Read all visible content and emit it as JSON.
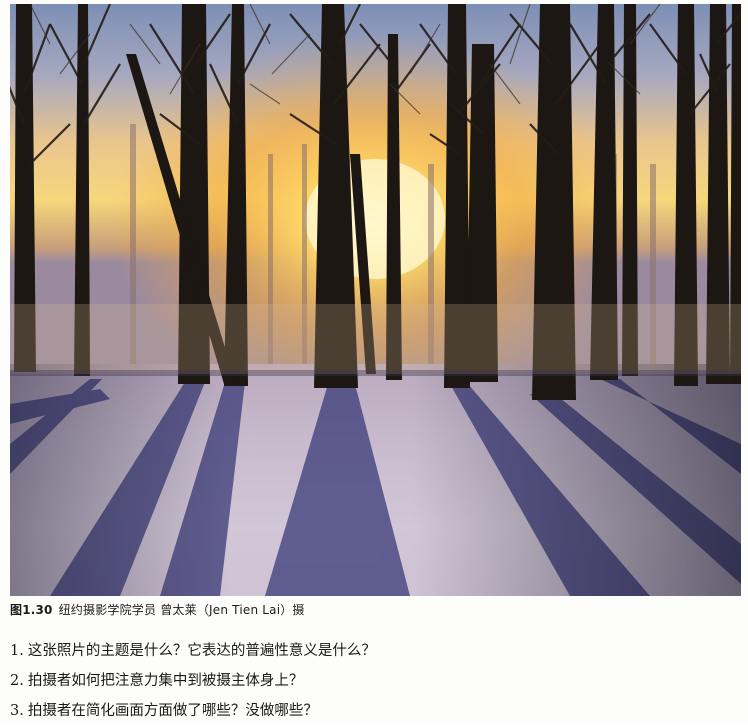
{
  "figure": {
    "photo_label": "winter forest at sunrise with long tree shadows on snow",
    "caption_number": "图1.30",
    "caption_text": "纽约摄影学院学员 曾太莱（Jen Tien Lai）摄"
  },
  "questions": [
    {
      "num": "1.",
      "text": "这张照片的主题是什么？它表达的普遍性意义是什么？"
    },
    {
      "num": "2.",
      "text": "拍摄者如何把注意力集中到被摄主体身上？"
    },
    {
      "num": "3.",
      "text": "拍摄者在简化画面方面做了哪些？没做哪些？"
    }
  ]
}
